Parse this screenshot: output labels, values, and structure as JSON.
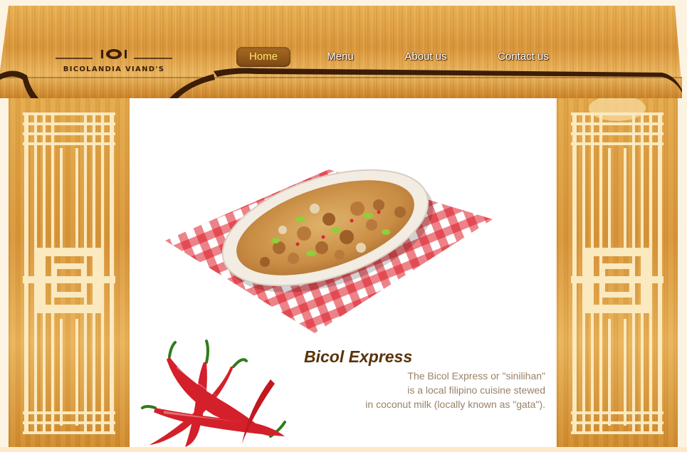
{
  "logo": {
    "text": "BICOLANDIA VIAND'S",
    "icon": "plate-fork-knife-icon"
  },
  "nav": {
    "items": [
      {
        "label": "Home",
        "active": true
      },
      {
        "label": "Menu",
        "active": false
      },
      {
        "label": "About us",
        "active": false
      },
      {
        "label": "Contact us",
        "active": false
      }
    ]
  },
  "hero": {
    "image": "bicol-express-dish-image"
  },
  "article": {
    "title": "Bicol Express",
    "lines": [
      "The Bicol Express or \"sinilihan\"",
      "is a local filipino cuisine stewed",
      "in coconut milk (locally known as \"gata\")."
    ],
    "image": "red-chili-peppers-image"
  },
  "colors": {
    "wood": "#dc9b40",
    "wood_dark": "#3b1d08",
    "nav_active_text": "#ffe46a",
    "title": "#5a3208",
    "body_text": "#9b8167"
  }
}
